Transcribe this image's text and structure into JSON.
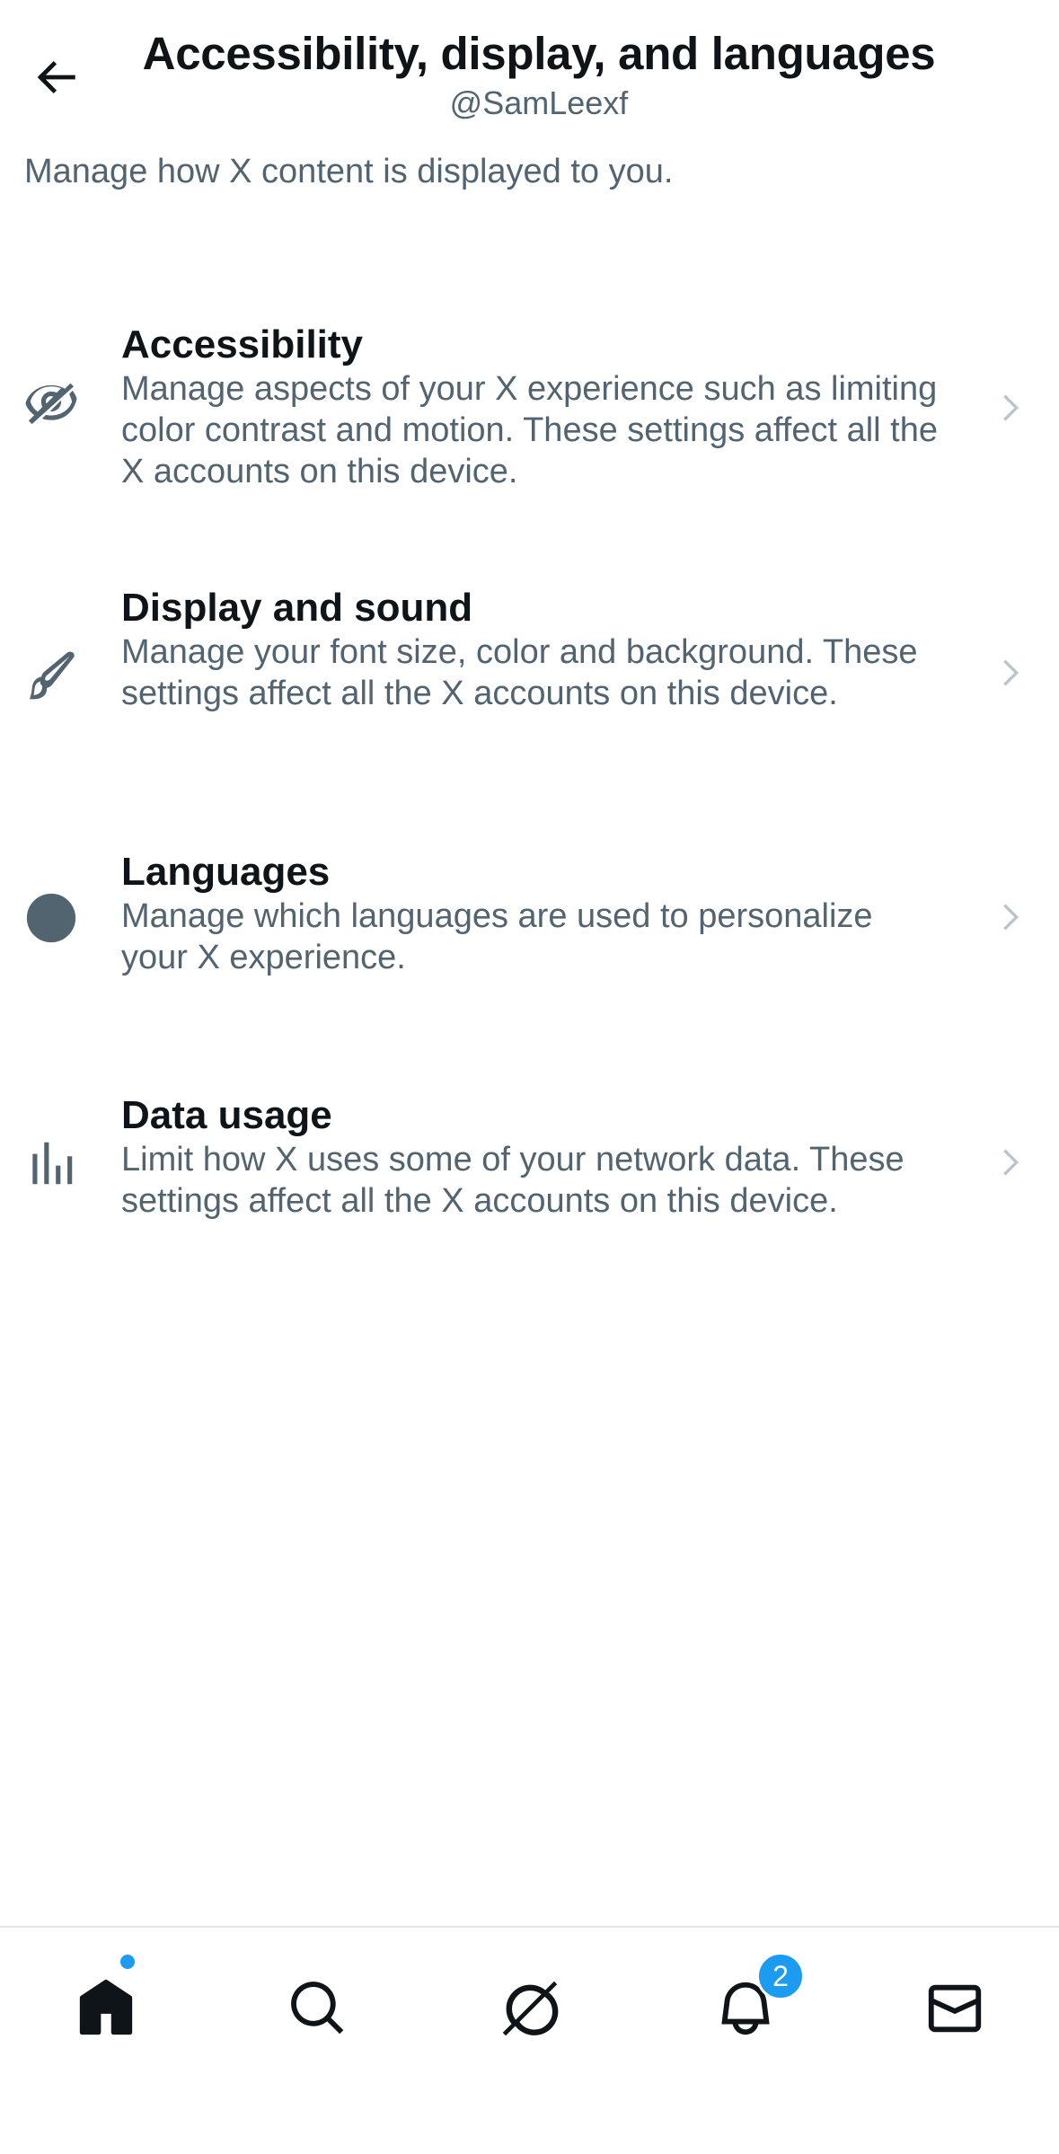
{
  "header": {
    "title": "Accessibility, display, and languages",
    "subtitle": "@SamLeexf",
    "back_icon": "arrow-left-icon"
  },
  "description": "Manage how X content is displayed to you.",
  "menu": {
    "items": [
      {
        "title": "Accessibility",
        "description": "Manage aspects of your X experience such as limiting color contrast and motion. These settings affect all the X accounts on this device.",
        "icon": "eye-slash-icon"
      },
      {
        "title": "Display and sound",
        "description": "Manage your font size, color and background. These settings affect all the X accounts on this device.",
        "icon": "brush-icon"
      },
      {
        "title": "Languages",
        "description": "Manage which languages are used to personalize your X experience.",
        "icon": "globe-icon"
      },
      {
        "title": "Data usage",
        "description": "Limit how X uses some of your network data. These settings affect all the X accounts on this device.",
        "icon": "bar-chart-icon"
      }
    ]
  },
  "bottom_nav": {
    "items": [
      {
        "icon": "home-icon"
      },
      {
        "icon": "search-icon"
      },
      {
        "icon": "grok-icon"
      },
      {
        "icon": "bell-icon"
      },
      {
        "icon": "mail-icon"
      }
    ],
    "notification_count": "2"
  },
  "colors": {
    "accent": "#1d9bf0",
    "primary_text": "#0f1419",
    "secondary_text": "#536471",
    "chevron": "#b9c4cc"
  }
}
